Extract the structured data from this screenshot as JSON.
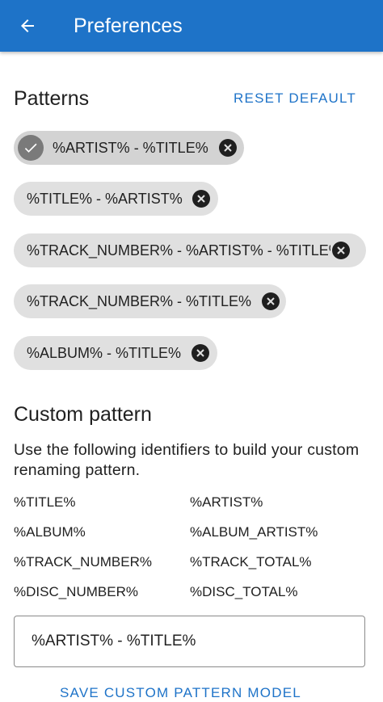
{
  "appbar": {
    "title": "Preferences",
    "back_icon": "arrow-back-icon",
    "color": "#1e73c8"
  },
  "patterns": {
    "heading": "Patterns",
    "reset_label": "RESET DEFAULT",
    "chips": [
      {
        "label": "%ARTIST% - %TITLE%",
        "selected": true
      },
      {
        "label": "%TITLE% - %ARTIST%",
        "selected": false
      },
      {
        "label": "%TRACK_NUMBER% - %ARTIST% - %TITLE%",
        "selected": false
      },
      {
        "label": "%TRACK_NUMBER% - %TITLE%",
        "selected": false
      },
      {
        "label": "%ALBUM% - %TITLE%",
        "selected": false
      }
    ]
  },
  "custom": {
    "heading": "Custom pattern",
    "description": "Use the following identifiers to build your custom renaming pattern.",
    "identifiers": [
      [
        "%TITLE%",
        "%ARTIST%"
      ],
      [
        "%ALBUM%",
        "%ALBUM_ARTIST%"
      ],
      [
        "%TRACK_NUMBER%",
        "%TRACK_TOTAL%"
      ],
      [
        "%DISC_NUMBER%",
        "%DISC_TOTAL%"
      ]
    ],
    "input_value": "%ARTIST% - %TITLE%",
    "save_label": "SAVE CUSTOM PATTERN MODEL"
  }
}
